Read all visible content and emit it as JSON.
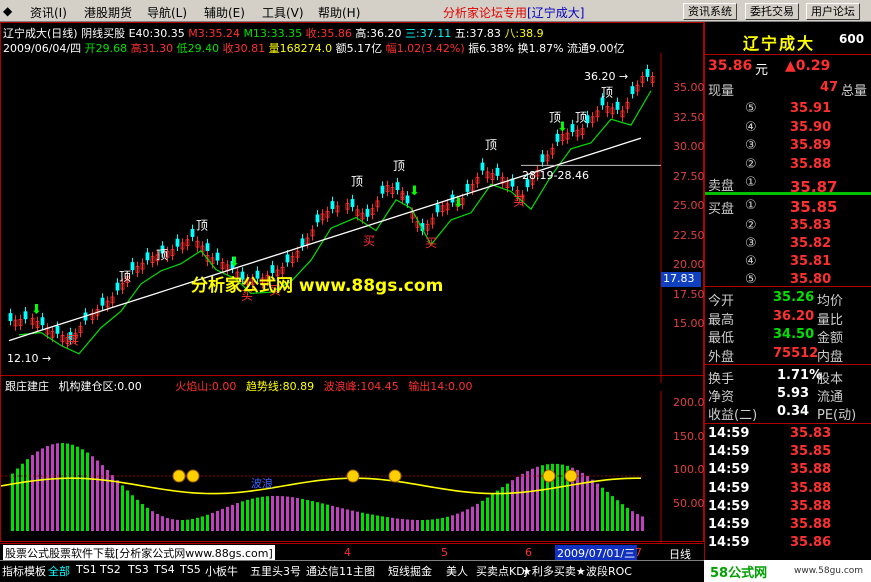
{
  "menu": {
    "items": [
      "资讯(I)",
      "港股期货",
      "导航(L)",
      "辅助(E)",
      "工具(V)",
      "帮助(H)"
    ],
    "forum": "分析家论坛专用",
    "stock_tag": "[辽宁成大]",
    "buttons": [
      "资讯系统",
      "委托交易",
      "用户论坛"
    ]
  },
  "header": {
    "line1": {
      "name": "辽宁成大(日线)",
      "indicator": "阴线买股",
      "e40": "E40:30.35",
      "m3": "M3:35.24",
      "m13": "M13:33.35",
      "recv": "收:35.86",
      "high": "高:36.20",
      "three": "三:37.11",
      "five": "五:37.83",
      "eight": "八:38.9"
    },
    "line2": {
      "date": "2009/06/04/四",
      "open": "开29.68",
      "high": "高31.30",
      "low": "低29.40",
      "close": "收30.81",
      "vol": "量168274.0",
      "amt": "额5.17亿",
      "chg": "幅1.02(3.42%)",
      "amp": "振6.38%",
      "turn": "换1.87%",
      "float": "流通9.00亿"
    }
  },
  "price_axis": [
    "35.00",
    "32.50",
    "30.00",
    "27.50",
    "25.00",
    "22.50",
    "20.00",
    "17.50",
    "15.00"
  ],
  "price_flag": "17.83",
  "ind_axis": [
    "200.0",
    "150.0",
    "100.0",
    "50.00"
  ],
  "annotations": {
    "low_label": "12.10",
    "high_label": "36.20",
    "range_label": "28.19-28.46",
    "top": "顶",
    "buy": "买",
    "watermark": "分析家公式网 www.88gs.com",
    "mid_text": "波浪"
  },
  "ind_header": {
    "name": "跟庄建庄",
    "a": "机构建仓区:0.00",
    "b": "火焰山:0.00",
    "c": "趋势线:80.89",
    "d": "波浪峰:104.45",
    "e": "输出14:0.00"
  },
  "date_axis": {
    "labels": [
      "4",
      "5",
      "6",
      "7"
    ],
    "cursor_date": "2009/07/01/三",
    "footer": "股票公式股票软件下载[分析家公式网www.88gs.com]",
    "period": "日线"
  },
  "tabs": [
    "指标",
    "模板",
    "全部",
    "TS1",
    "TS2",
    "TS3",
    "TS4",
    "TS5",
    "小板牛",
    "五里头3号",
    "通达信11主图",
    "短线掘金",
    "美人",
    "买卖点KDJ",
    "★利多买卖★",
    "波段ROC"
  ],
  "quote": {
    "name": "辽宁成大",
    "code": "600",
    "price": "35.86",
    "unit": "元",
    "change": "▲0.29",
    "volume_now_label": "现量",
    "volume_now": "47",
    "total_label": "总量",
    "sell": [
      {
        "n": "⑤",
        "p": "35.91"
      },
      {
        "n": "④",
        "p": "35.90"
      },
      {
        "n": "③",
        "p": "35.89"
      },
      {
        "n": "②",
        "p": "35.88"
      },
      {
        "n": "①",
        "p": "35.87"
      }
    ],
    "sell_label": "卖盘",
    "buy_label": "买盘",
    "buy": [
      {
        "n": "①",
        "p": "35.85"
      },
      {
        "n": "②",
        "p": "35.83"
      },
      {
        "n": "③",
        "p": "35.82"
      },
      {
        "n": "④",
        "p": "35.81"
      },
      {
        "n": "⑤",
        "p": "35.80"
      }
    ],
    "stats": [
      {
        "l": "今开",
        "v": "35.26",
        "c": "grn",
        "r": "均价"
      },
      {
        "l": "最高",
        "v": "36.20",
        "c": "red",
        "r": "量比"
      },
      {
        "l": "最低",
        "v": "34.50",
        "c": "grn",
        "r": "金额"
      },
      {
        "l": "外盘",
        "v": "75512",
        "c": "red",
        "r": "内盘"
      }
    ],
    "stats2": [
      {
        "l": "换手",
        "v": "1.71%",
        "r": "股本"
      },
      {
        "l": "净资",
        "v": "5.93",
        "r": "流通"
      },
      {
        "l": "收益(二)",
        "v": "0.34",
        "r": "PE(动)"
      }
    ],
    "ticks": [
      {
        "t": "14:59",
        "p": "35.83"
      },
      {
        "t": "14:59",
        "p": "35.85"
      },
      {
        "t": "14:59",
        "p": "35.88"
      },
      {
        "t": "14:59",
        "p": "35.88"
      },
      {
        "t": "14:59",
        "p": "35.88"
      },
      {
        "t": "14:59",
        "p": "35.88"
      },
      {
        "t": "14:59",
        "p": "35.86"
      }
    ],
    "site": "58公式网",
    "site_url": "www.58gu.com"
  }
}
